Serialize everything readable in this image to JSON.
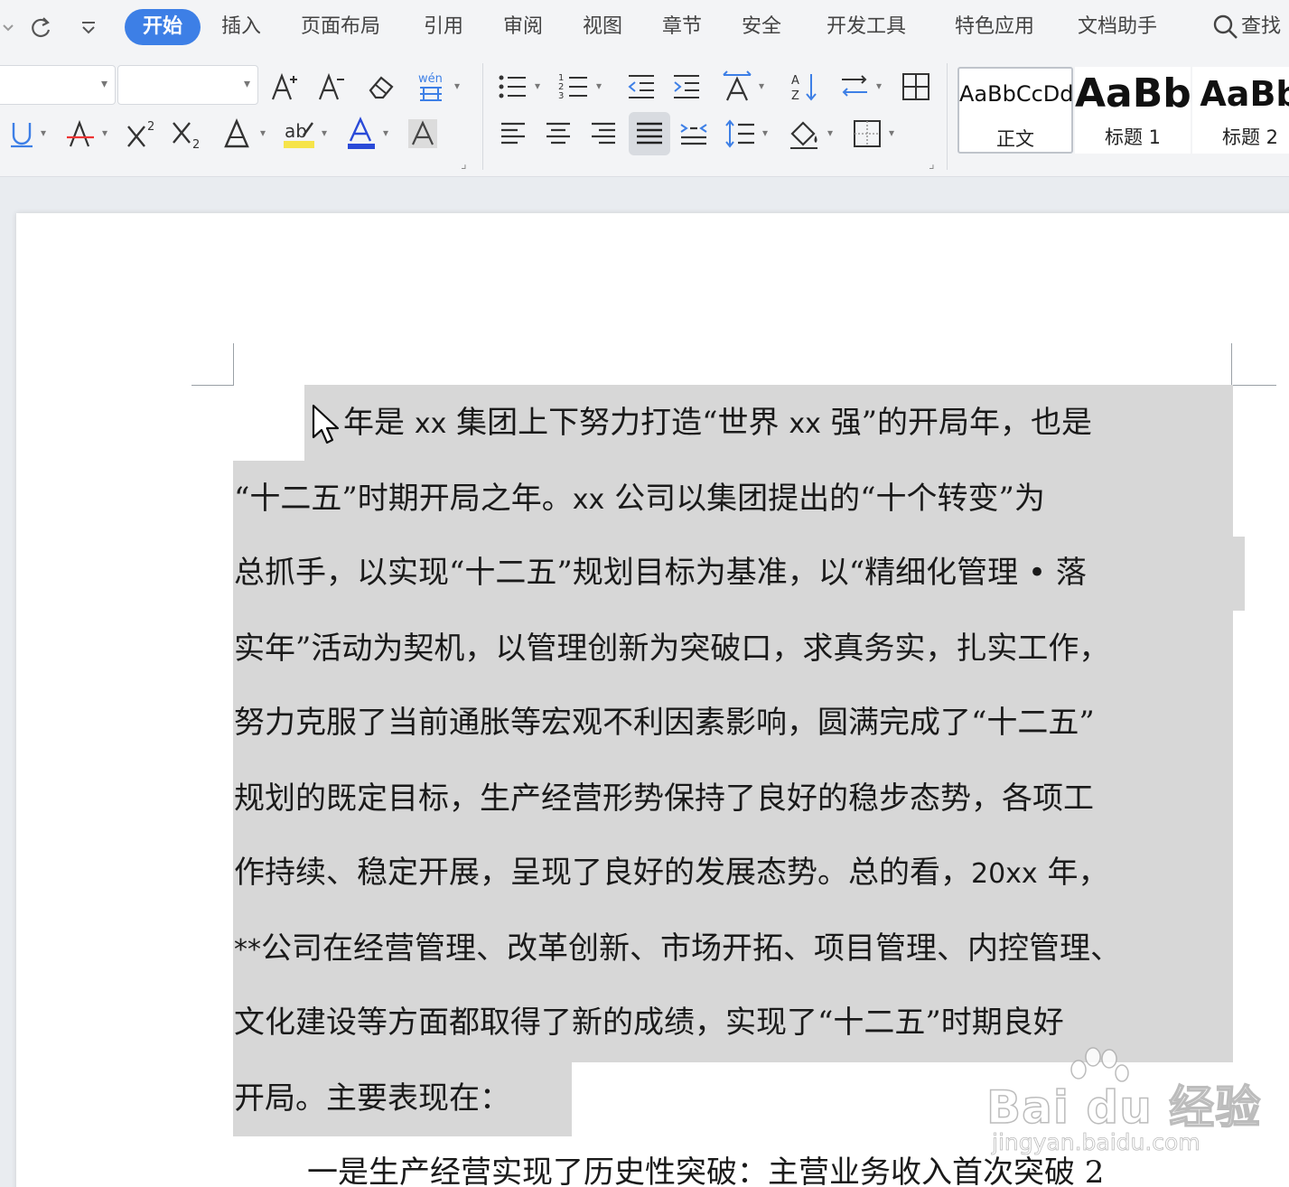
{
  "menu": {
    "tabs": [
      "开始",
      "插入",
      "页面布局",
      "引用",
      "审阅",
      "视图",
      "章节",
      "安全",
      "开发工具",
      "特色应用",
      "文档助手"
    ],
    "active_tab": "开始",
    "search_label": "查找"
  },
  "ribbon": {
    "styles": [
      {
        "sample": "AaBbCcDd",
        "name": "正文"
      },
      {
        "sample": "AaBb",
        "name": "标题 1"
      },
      {
        "sample": "AaBb",
        "name": "标题 2"
      }
    ],
    "colors": {
      "highlight": "#f6e44a",
      "font_color": "#2a4ad8",
      "accent": "#3d7fe6"
    }
  },
  "document": {
    "lines": [
      [
        "年是 ",
        "xx",
        " 集团上下努力打造“世界 ",
        "xx",
        " 强”的开局年，也是"
      ],
      [
        "“十二五”时期开局之年。",
        "xx",
        " 公司以集团提出的“十个转变”为"
      ],
      [
        "总抓手，以实现“十二五”规划目标为基准，以“精细化管理 • 落"
      ],
      [
        "实年”活动为契机，以管理创新为突破口，求真务实，扎实工作，"
      ],
      [
        "努力克服了当前通胀等宏观不利因素影响，圆满完成了“十二五”"
      ],
      [
        "规划的既定目标，生产经营形势保持了良好的稳步态势，各项工"
      ],
      [
        "作持续、稳定开展，呈现了良好的发展态势。总的看，",
        "20xx",
        " 年，"
      ],
      [
        "**",
        "公司在经营管理、改革创新、市场开拓、项目管理、内控管理、"
      ],
      [
        "文化建设等方面都取得了新的成绩，实现了“十二五”时期良好"
      ],
      [
        "开局。主要表现在："
      ],
      [
        "一是生产经营实现了历史性突破：主营业务收入首次突破 2"
      ]
    ]
  },
  "watermark": {
    "logo": "Bai du 经验",
    "url": "jingyan.baidu.com"
  }
}
